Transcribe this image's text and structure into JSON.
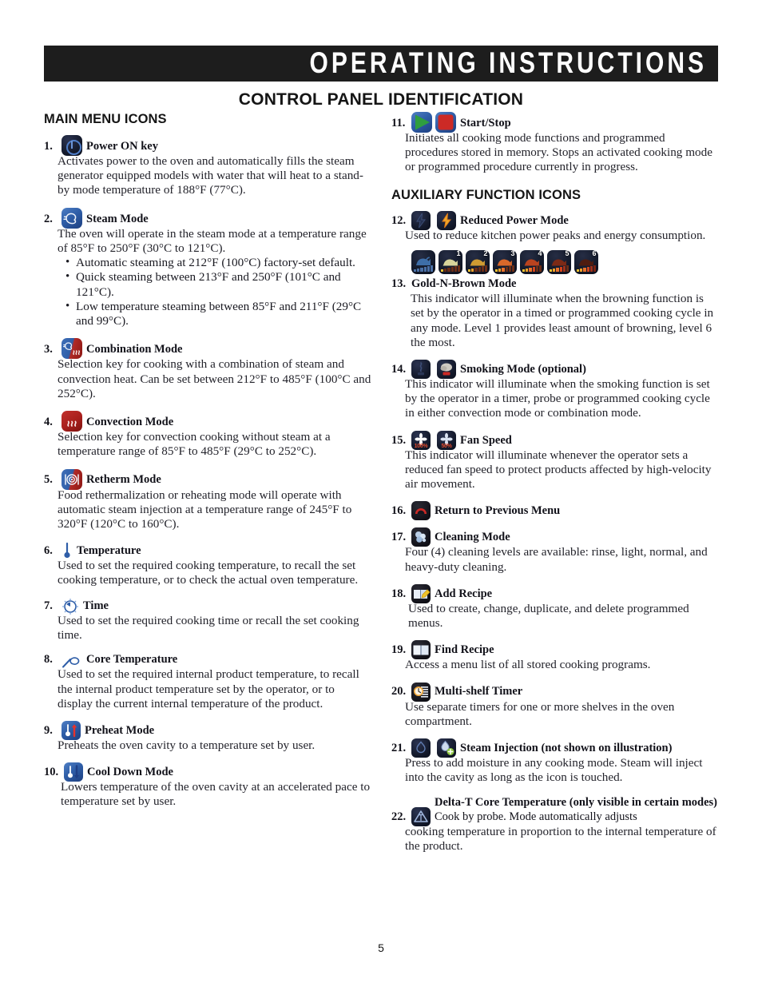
{
  "banner": {
    "title": "OPERATING INSTRUCTIONS"
  },
  "page_heading": "CONTROL PANEL IDENTIFICATION",
  "page_number": "5",
  "left_column": {
    "section_title": "MAIN MENU ICONS",
    "items": [
      {
        "num": "1.",
        "title": "Power ON key",
        "body": "Activates power to the oven and automatically fills the steam generator equipped models with water that will heat to a stand-by mode temperature of 188°F (77°C).",
        "icons": [
          "power-on-icon"
        ]
      },
      {
        "num": "2.",
        "title": "Steam Mode",
        "body": "The oven will operate in the steam mode at a temperature range of 85°F to 250°F (30°C to 121°C).",
        "bullets": [
          "Automatic steaming at 212°F (100°C) factory-set default.",
          "Quick steaming between 213°F and 250°F (101°C and 121°C).",
          "Low temperature steaming between 85°F and 211°F (29°C and 99°C)."
        ],
        "icons": [
          "steam-mode-icon"
        ]
      },
      {
        "num": "3.",
        "title": "Combination Mode",
        "body": "Selection key for cooking with a combination of steam and convection heat. Can be set between 212°F to 485°F (100°C and 252°C).",
        "icons": [
          "combination-mode-icon"
        ]
      },
      {
        "num": "4.",
        "title": "Convection Mode",
        "body": "Selection key for convection cooking without steam at a temperature range of 85°F to 485°F (29°C to 252°C).",
        "icons": [
          "convection-mode-icon"
        ]
      },
      {
        "num": "5.",
        "title": "Retherm Mode",
        "body": "Food rethermalization or reheating mode will operate with automatic steam injection at a temperature range of 245°F to 320°F (120°C to 160°C).",
        "icons": [
          "retherm-mode-icon"
        ]
      },
      {
        "num": "6.",
        "title": "Temperature",
        "body": "Used to set the required cooking temperature, to recall the set cooking temperature, or to check the actual oven temperature.",
        "icons": [
          "thermometer-icon"
        ]
      },
      {
        "num": "7.",
        "title": "Time",
        "body": "Used to set the required cooking time or recall the set cooking time.",
        "icons": [
          "clock-icon"
        ]
      },
      {
        "num": "8.",
        "title": "Core Temperature",
        "body": "Used to set the required internal product temperature, to recall the internal product temperature set by the operator, or to display the current internal temperature of the product.",
        "icons": [
          "core-probe-icon"
        ]
      },
      {
        "num": "9.",
        "title": "Preheat Mode",
        "body": "Preheats the oven cavity to a temperature set by user.",
        "icons": [
          "preheat-icon"
        ]
      },
      {
        "num": "10.",
        "title": "Cool Down Mode",
        "body": "Lowers temperature of the oven cavity at an accelerated pace to temperature set by user.",
        "icons": [
          "cool-down-icon"
        ]
      }
    ]
  },
  "right_column": {
    "section_title": "AUXILIARY FUNCTION ICONS",
    "items": [
      {
        "num": "11.",
        "title": "Start/Stop",
        "body": "Initiates all cooking mode functions and programmed procedures stored in memory. Stops an activated cooking mode or programmed procedure currently in progress.",
        "icons": [
          "start-icon",
          "stop-icon"
        ]
      },
      {
        "num": "12.",
        "title": "Reduced Power Mode",
        "body": "Used to reduce kitchen power peaks and energy consumption.",
        "icons": [
          "reduced-power-off-icon",
          "reduced-power-on-icon"
        ]
      },
      {
        "num": "13.",
        "title": "Gold-N-Brown Mode",
        "body": "This indicator will illuminate when the browning function is set by the operator in a timed or programmed cooking cycle in any mode. Level 1 provides least amount of browning, level 6 the most.",
        "icons": [
          "gold-n-brown-off-icon",
          "gold-n-brown-level-1-icon",
          "gold-n-brown-level-2-icon",
          "gold-n-brown-level-3-icon",
          "gold-n-brown-level-4-icon",
          "gold-n-brown-level-5-icon",
          "gold-n-brown-level-6-icon"
        ],
        "levels": [
          "1",
          "2",
          "3",
          "4",
          "5",
          "6"
        ]
      },
      {
        "num": "14.",
        "title": "Smoking Mode (optional)",
        "body": "This indicator will illuminate when the smoking function is set by the operator in a timer, probe or programmed cooking cycle in either convection mode or combination mode.",
        "icons": [
          "smoking-off-icon",
          "smoking-on-icon"
        ]
      },
      {
        "num": "15.",
        "title": "Fan Speed",
        "body": "This indicator will illuminate whenever the operator sets a reduced fan speed to protect products affected by high-velocity air movement.",
        "icons": [
          "fan-speed-100-icon",
          "fan-speed-50-icon"
        ],
        "fan_labels": [
          "100%",
          "50%"
        ]
      },
      {
        "num": "16.",
        "title": "Return to Previous Menu",
        "body": "",
        "icons": [
          "return-icon"
        ]
      },
      {
        "num": "17.",
        "title": "Cleaning Mode",
        "body": "Four (4) cleaning levels are available: rinse, light, normal, and heavy-duty cleaning.",
        "icons": [
          "cleaning-icon"
        ]
      },
      {
        "num": "18.",
        "title": "Add Recipe",
        "body": "Used to create, change, duplicate, and delete programmed menus.",
        "icons": [
          "add-recipe-icon"
        ]
      },
      {
        "num": "19.",
        "title": "Find Recipe",
        "body": "Access a menu list of all stored cooking programs.",
        "icons": [
          "find-recipe-icon"
        ]
      },
      {
        "num": "20.",
        "title": "Multi-shelf Timer",
        "body": "Use separate timers for one or more shelves in the oven compartment.",
        "icons": [
          "multi-shelf-timer-icon"
        ]
      },
      {
        "num": "21.",
        "title": "Steam Injection (not shown on illustration)",
        "body": "Press to add moisture in any cooking mode. Steam will inject into the cavity as long as the icon is touched.",
        "icons": [
          "steam-injection-off-icon",
          "steam-injection-on-icon"
        ]
      },
      {
        "num": "22.",
        "title": "Delta-T Core Temperature (only visible in certain modes)",
        "title_rest": " Cook by probe. Mode automatically adjusts",
        "body": "cooking temperature in proportion to the internal temperature of the product.",
        "icons": [
          "delta-t-icon"
        ]
      }
    ]
  },
  "colors": {
    "banner_bg": "#1d1d1d",
    "icon_navy": "#141a2c",
    "icon_blue": "#2f5ea8",
    "icon_red": "#a81f1c",
    "accent_green": "#2f9e3f",
    "accent_orange": "#e8952a"
  }
}
